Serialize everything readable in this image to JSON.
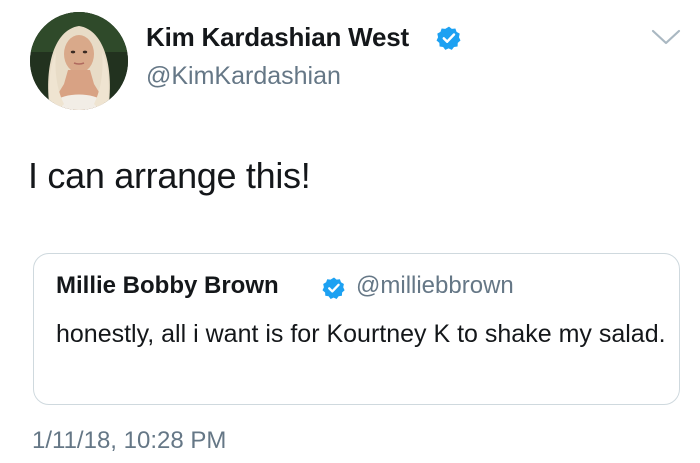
{
  "author": {
    "display_name": "Kim Kardashian West",
    "handle": "@KimKardashian",
    "verified": true,
    "avatar_icon": "profile-photo"
  },
  "tweet": {
    "text": "I can arrange this!",
    "timestamp": "1/11/18, 10:28 PM"
  },
  "quoted_tweet": {
    "display_name": "Millie Bobby Brown",
    "handle": "@milliebbrown",
    "verified": true,
    "text": "honestly, all i want is for Kourtney K to shake my salad."
  },
  "colors": {
    "verified_blue": "#1da1f2",
    "secondary_text": "#657786",
    "primary_text": "#14171a",
    "border": "#cfd9de"
  },
  "icons": {
    "verified": "verified-badge-icon",
    "more": "chevron-down-icon"
  }
}
